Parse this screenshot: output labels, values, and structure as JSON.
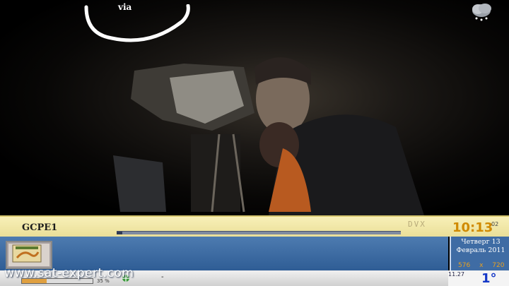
{
  "overlay": {
    "via_text": "via",
    "weather_icon": "cloud-snow-icon"
  },
  "infobar": {
    "channel_name": "GCPE1",
    "program_progress": 0.02,
    "format_badge": "DVX",
    "clock_time": "10:13",
    "clock_seconds": "02",
    "date_line1": "Четверг 13",
    "date_line2": "Февраль 2011",
    "resolution_width": "576",
    "resolution_sep": "x",
    "resolution_height": "720",
    "signal_small_text": "",
    "signal_level": 0.35,
    "signal_pct": "35 %",
    "rec_icon": "signal-antenna-icon",
    "dash": "-",
    "time_small": "11.27",
    "temperature": "1°",
    "watermark": "www.sat-expert.com",
    "colors": {
      "bar_top": "#f8f0b8",
      "bar_mid": "#3f6ca4",
      "clock": "#d08a00",
      "temperature": "#1538c8"
    }
  }
}
